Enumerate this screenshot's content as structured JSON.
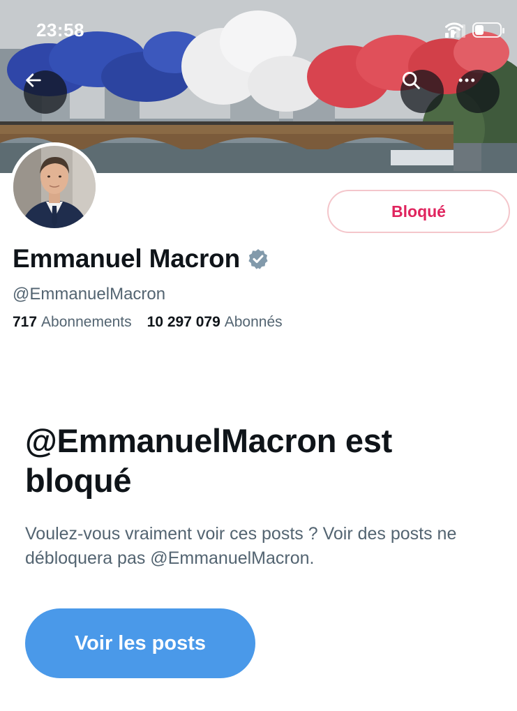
{
  "status_bar": {
    "time": "23:58"
  },
  "header": {
    "back_icon": "arrow-left-icon",
    "search_icon": "search-icon",
    "more_icon": "more-horizontal-icon"
  },
  "profile": {
    "block_button_label": "Bloqué",
    "name": "Emmanuel Macron",
    "verified_icon": "verified-badge-icon",
    "handle": "@EmmanuelMacron",
    "following_count": "717",
    "following_label": "Abonnements",
    "followers_count": "10 297 079",
    "followers_label": "Abonnés"
  },
  "blocked_notice": {
    "title": "@EmmanuelMacron est bloqué",
    "description": "Voulez-vous vraiment voir ces posts ? Voir des posts ne débloquera pas @EmmanuelMacron.",
    "button_label": "Voir les posts"
  },
  "colors": {
    "blocked_red": "#e0245e",
    "primary_blue": "#4a99e9",
    "secondary_text": "#536471",
    "verified_gray": "#829aab"
  }
}
